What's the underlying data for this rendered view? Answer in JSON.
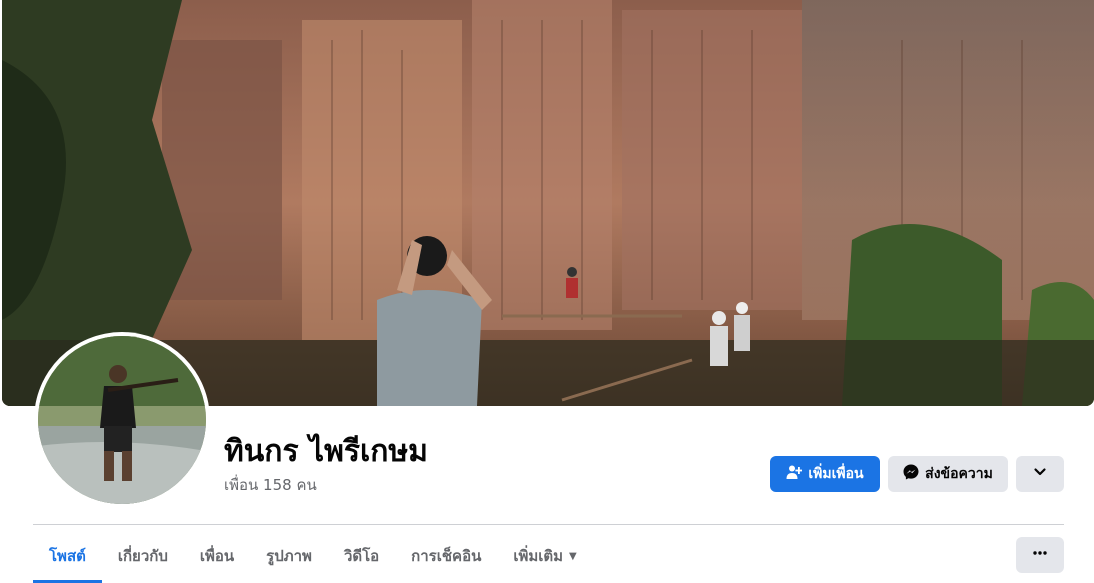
{
  "profile": {
    "name": "ทินกร ไพรีเกษม",
    "friends_text": "เพื่อน 158 คน"
  },
  "actions": {
    "add_friend_label": "เพิ่มเพื่อน",
    "message_label": "ส่งข้อความ",
    "add_friend_icon": "person-add-icon",
    "message_icon": "messenger-icon",
    "dropdown_icon": "chevron-down-icon",
    "more_icon": "more-dots-icon"
  },
  "tabs": [
    {
      "label": "โพสต์",
      "active": true
    },
    {
      "label": "เกี่ยวกับ",
      "active": false
    },
    {
      "label": "เพื่อน",
      "active": false
    },
    {
      "label": "รูปภาพ",
      "active": false
    },
    {
      "label": "วิดีโอ",
      "active": false
    },
    {
      "label": "การเช็คอิน",
      "active": false
    },
    {
      "label": "เพิ่มเติม",
      "active": false
    }
  ],
  "colors": {
    "primary": "#1b74e4",
    "secondary_button": "#e4e6eb",
    "text_secondary": "#65676b"
  }
}
